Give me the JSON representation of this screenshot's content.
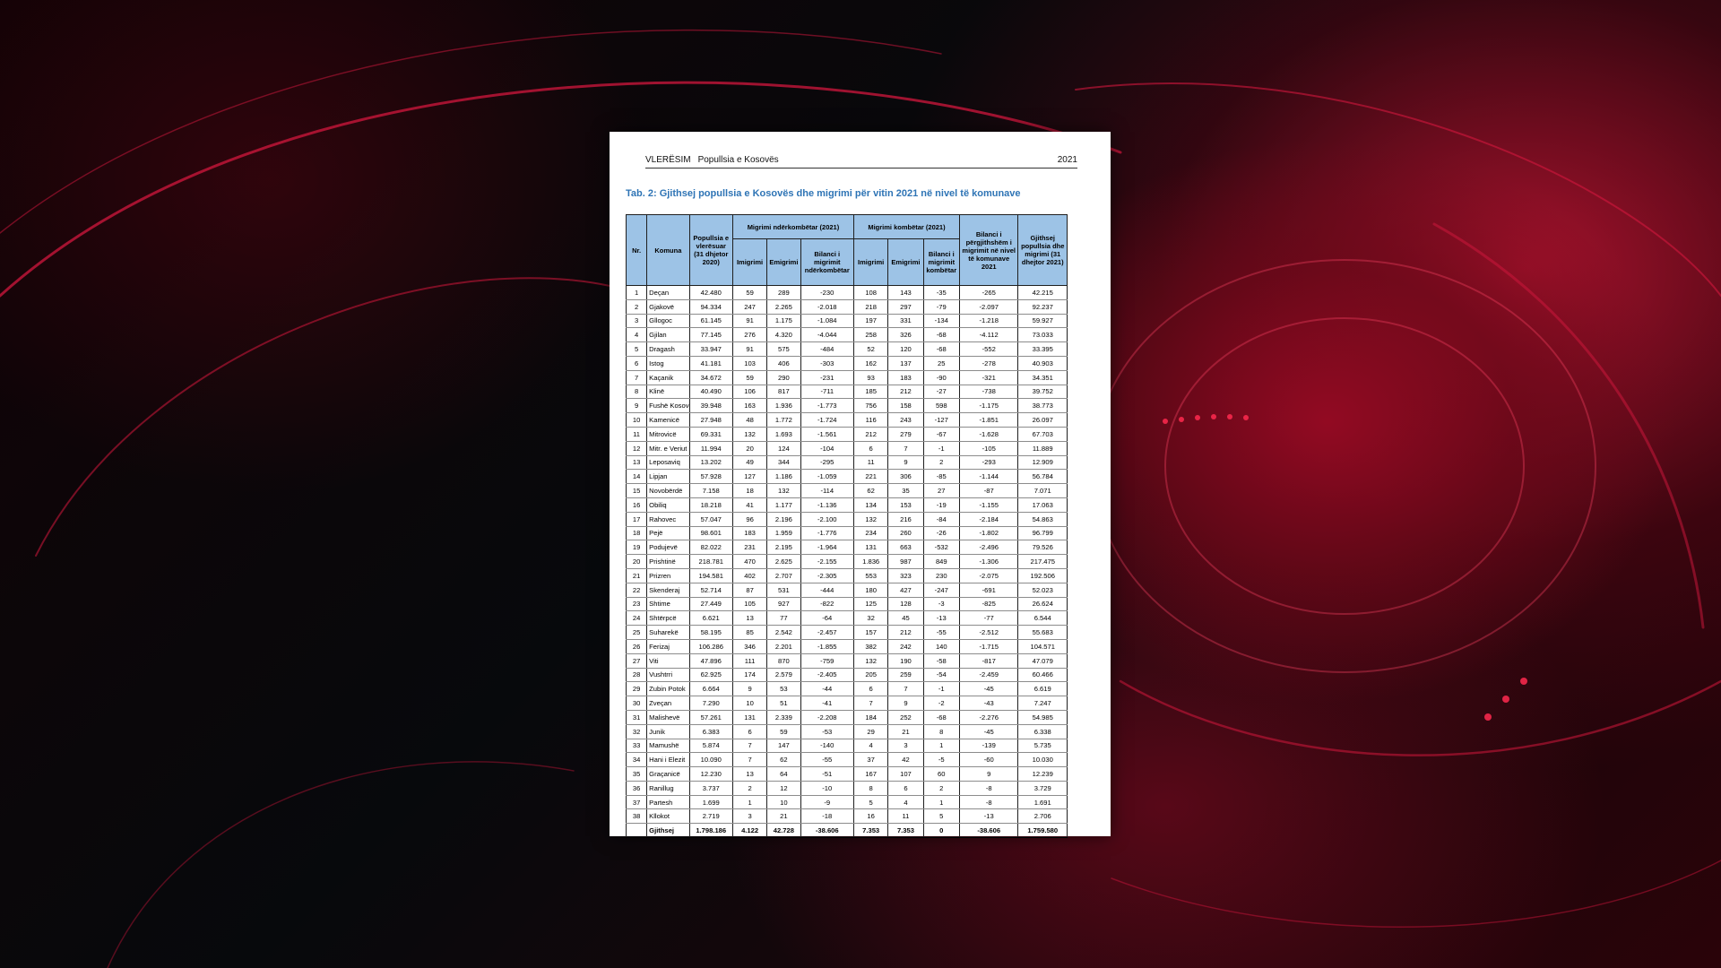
{
  "document": {
    "header_left_1": "VLERËSIM",
    "header_left_2": "Popullsia e Kosovës",
    "header_right": "2021",
    "title": "Tab.  2: Gjithsej popullsia e Kosovës dhe migrimi për vitin 2021 në nivel të komunave"
  },
  "table": {
    "headers": {
      "nr": "Nr.",
      "komuna": "Komuna",
      "pop2020": "Popullsia e vlerësuar (31 dhjetor 2020)",
      "group_international": "Migrimi ndërkombëtar (2021)",
      "group_national": "Migrimi kombëtar (2021)",
      "imigrimi_int": "Imigrimi",
      "emigrimi_int": "Emigrimi",
      "bilanci_int": "Bilanci i migrimit ndërkombëtar",
      "imigrimi_nat": "Imigrimi",
      "emigrimi_nat": "Emigrimi",
      "bilanci_nat": "Bilanci i migrimit kombëtar",
      "bilanci_total": "Bilanci i përgjithshëm i migrimit në nivel të komunave 2021",
      "pop2021": "Gjithsej popullsia dhe migrimi (31 dhejtor 2021)"
    },
    "rows": [
      [
        "1",
        "Deçan",
        "42.480",
        "59",
        "289",
        "-230",
        "108",
        "143",
        "-35",
        "-265",
        "42.215"
      ],
      [
        "2",
        "Gjakovë",
        "94.334",
        "247",
        "2.265",
        "-2.018",
        "218",
        "297",
        "-79",
        "-2.097",
        "92.237"
      ],
      [
        "3",
        "Gllogoc",
        "61.145",
        "91",
        "1.175",
        "-1.084",
        "197",
        "331",
        "-134",
        "-1.218",
        "59.927"
      ],
      [
        "4",
        "Gjilan",
        "77.145",
        "276",
        "4.320",
        "-4.044",
        "258",
        "326",
        "-68",
        "-4.112",
        "73.033"
      ],
      [
        "5",
        "Dragash",
        "33.947",
        "91",
        "575",
        "-484",
        "52",
        "120",
        "-68",
        "-552",
        "33.395"
      ],
      [
        "6",
        "Istog",
        "41.181",
        "103",
        "406",
        "-303",
        "162",
        "137",
        "25",
        "-278",
        "40.903"
      ],
      [
        "7",
        "Kaçanik",
        "34.672",
        "59",
        "290",
        "-231",
        "93",
        "183",
        "-90",
        "-321",
        "34.351"
      ],
      [
        "8",
        "Klinë",
        "40.490",
        "106",
        "817",
        "-711",
        "185",
        "212",
        "-27",
        "-738",
        "39.752"
      ],
      [
        "9",
        "Fushë Kosove",
        "39.948",
        "163",
        "1.936",
        "-1.773",
        "756",
        "158",
        "598",
        "-1.175",
        "38.773"
      ],
      [
        "10",
        "Kamenicë",
        "27.948",
        "48",
        "1.772",
        "-1.724",
        "116",
        "243",
        "-127",
        "-1.851",
        "26.097"
      ],
      [
        "11",
        "Mitrovicë",
        "69.331",
        "132",
        "1.693",
        "-1.561",
        "212",
        "279",
        "-67",
        "-1.628",
        "67.703"
      ],
      [
        "12",
        "Mitr. e Veriut",
        "11.994",
        "20",
        "124",
        "-104",
        "6",
        "7",
        "-1",
        "-105",
        "11.889"
      ],
      [
        "13",
        "Leposaviq",
        "13.202",
        "49",
        "344",
        "-295",
        "11",
        "9",
        "2",
        "-293",
        "12.909"
      ],
      [
        "14",
        "Lipjan",
        "57.928",
        "127",
        "1.186",
        "-1.059",
        "221",
        "306",
        "-85",
        "-1.144",
        "56.784"
      ],
      [
        "15",
        "Novobërdë",
        "7.158",
        "18",
        "132",
        "-114",
        "62",
        "35",
        "27",
        "-87",
        "7.071"
      ],
      [
        "16",
        "Obiliq",
        "18.218",
        "41",
        "1.177",
        "-1.136",
        "134",
        "153",
        "-19",
        "-1.155",
        "17.063"
      ],
      [
        "17",
        "Rahovec",
        "57.047",
        "96",
        "2.196",
        "-2.100",
        "132",
        "216",
        "-84",
        "-2.184",
        "54.863"
      ],
      [
        "18",
        "Pejë",
        "98.601",
        "183",
        "1.959",
        "-1.776",
        "234",
        "260",
        "-26",
        "-1.802",
        "96.799"
      ],
      [
        "19",
        "Podujevë",
        "82.022",
        "231",
        "2.195",
        "-1.964",
        "131",
        "663",
        "-532",
        "-2.496",
        "79.526"
      ],
      [
        "20",
        "Prishtinë",
        "218.781",
        "470",
        "2.625",
        "-2.155",
        "1.836",
        "987",
        "849",
        "-1.306",
        "217.475"
      ],
      [
        "21",
        "Prizren",
        "194.581",
        "402",
        "2.707",
        "-2.305",
        "553",
        "323",
        "230",
        "-2.075",
        "192.506"
      ],
      [
        "22",
        "Skenderaj",
        "52.714",
        "87",
        "531",
        "-444",
        "180",
        "427",
        "-247",
        "-691",
        "52.023"
      ],
      [
        "23",
        "Shtime",
        "27.449",
        "105",
        "927",
        "-822",
        "125",
        "128",
        "-3",
        "-825",
        "26.624"
      ],
      [
        "24",
        "Shtërpcë",
        "6.621",
        "13",
        "77",
        "-64",
        "32",
        "45",
        "-13",
        "-77",
        "6.544"
      ],
      [
        "25",
        "Suharekë",
        "58.195",
        "85",
        "2.542",
        "-2.457",
        "157",
        "212",
        "-55",
        "-2.512",
        "55.683"
      ],
      [
        "26",
        "Ferizaj",
        "106.286",
        "346",
        "2.201",
        "-1.855",
        "382",
        "242",
        "140",
        "-1.715",
        "104.571"
      ],
      [
        "27",
        "Viti",
        "47.896",
        "111",
        "870",
        "-759",
        "132",
        "190",
        "-58",
        "-817",
        "47.079"
      ],
      [
        "28",
        "Vushtrri",
        "62.925",
        "174",
        "2.579",
        "-2.405",
        "205",
        "259",
        "-54",
        "-2.459",
        "60.466"
      ],
      [
        "29",
        "Zubin Potok",
        "6.664",
        "9",
        "53",
        "-44",
        "6",
        "7",
        "-1",
        "-45",
        "6.619"
      ],
      [
        "30",
        "Zveçan",
        "7.290",
        "10",
        "51",
        "-41",
        "7",
        "9",
        "-2",
        "-43",
        "7.247"
      ],
      [
        "31",
        "Malishevë",
        "57.261",
        "131",
        "2.339",
        "-2.208",
        "184",
        "252",
        "-68",
        "-2.276",
        "54.985"
      ],
      [
        "32",
        "Junik",
        "6.383",
        "6",
        "59",
        "-53",
        "29",
        "21",
        "8",
        "-45",
        "6.338"
      ],
      [
        "33",
        "Mamushë",
        "5.874",
        "7",
        "147",
        "-140",
        "4",
        "3",
        "1",
        "-139",
        "5.735"
      ],
      [
        "34",
        "Hani i Elezit",
        "10.090",
        "7",
        "62",
        "-55",
        "37",
        "42",
        "-5",
        "-60",
        "10.030"
      ],
      [
        "35",
        "Graçanicë",
        "12.230",
        "13",
        "64",
        "-51",
        "167",
        "107",
        "60",
        "9",
        "12.239"
      ],
      [
        "36",
        "Ranillug",
        "3.737",
        "2",
        "12",
        "-10",
        "8",
        "6",
        "2",
        "-8",
        "3.729"
      ],
      [
        "37",
        "Partesh",
        "1.699",
        "1",
        "10",
        "-9",
        "5",
        "4",
        "1",
        "-8",
        "1.691"
      ],
      [
        "38",
        "Kllokot",
        "2.719",
        "3",
        "21",
        "-18",
        "16",
        "11",
        "5",
        "-13",
        "2.706"
      ]
    ],
    "total": [
      "",
      "Gjithsej",
      "1.798.186",
      "4.122",
      "42.728",
      "-38.606",
      "7.353",
      "7.353",
      "0",
      "-38.606",
      "1.759.580"
    ]
  }
}
